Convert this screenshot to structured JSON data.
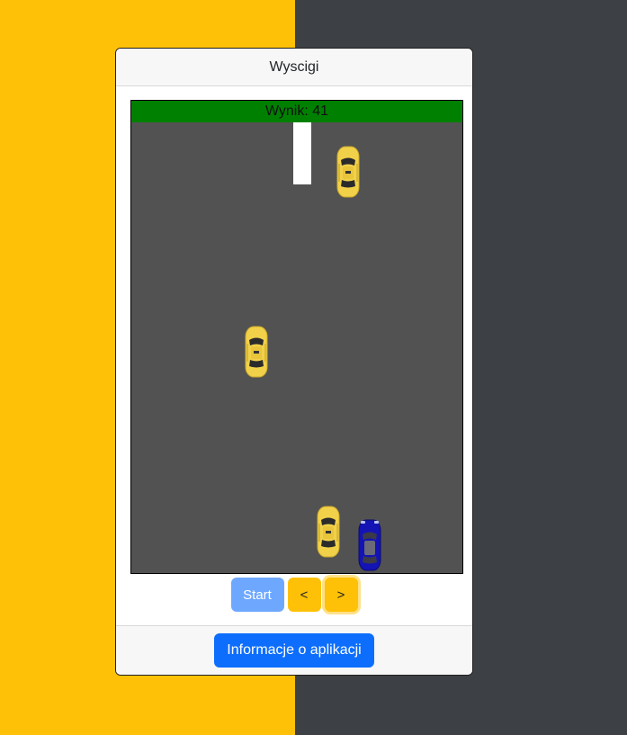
{
  "colors": {
    "background_left": "#ffc107",
    "background_right": "#3d4044",
    "road": "#525252",
    "score_bar": "#008000",
    "start_button": "#6ea8fe",
    "arrow_button": "#ffc107",
    "info_button": "#0d6efd",
    "taxi_body": "#f2d14a",
    "player_body": "#1414b4"
  },
  "header": {
    "title": "Wyscigi"
  },
  "game": {
    "score_text": "Wynik: 41",
    "player_car": {
      "icon": "blue-car-icon"
    },
    "enemy_cars": [
      {
        "icon": "yellow-taxi-icon"
      },
      {
        "icon": "yellow-taxi-icon"
      },
      {
        "icon": "yellow-taxi-icon"
      }
    ]
  },
  "controls": {
    "start_label": "Start",
    "left_label": "<",
    "right_label": ">"
  },
  "footer": {
    "info_label": "Informacje o aplikacji"
  }
}
